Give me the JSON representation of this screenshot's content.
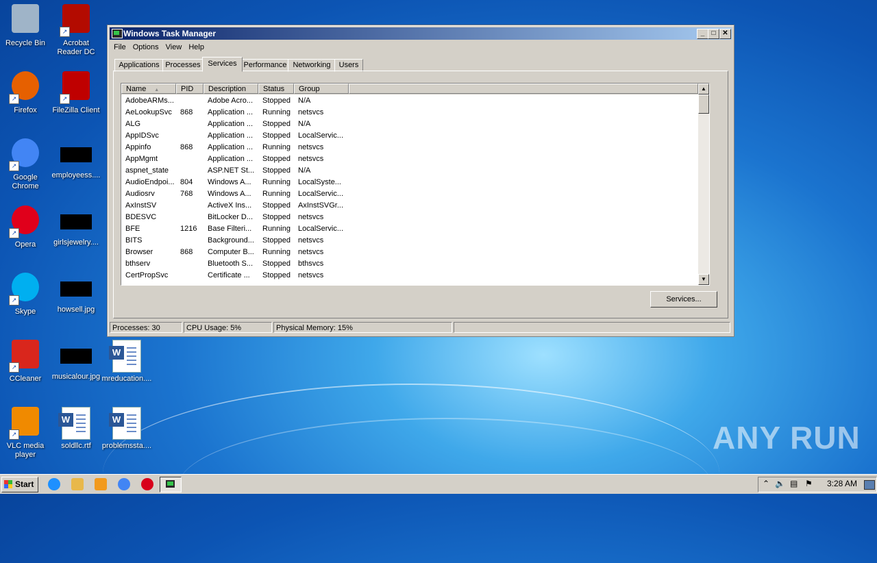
{
  "desktop": {
    "icons": [
      {
        "label": "Recycle Bin",
        "icon": "recycle-bin-icon"
      },
      {
        "label": "Acrobat Reader DC",
        "icon": "acrobat-icon"
      },
      {
        "label": "Firefox",
        "icon": "firefox-icon"
      },
      {
        "label": "FileZilla Client",
        "icon": "filezilla-icon"
      },
      {
        "label": "Google Chrome",
        "icon": "chrome-icon"
      },
      {
        "label": "employeess....",
        "icon": "image-thumbnail-icon"
      },
      {
        "label": "Opera",
        "icon": "opera-icon"
      },
      {
        "label": "girlsjewelry....",
        "icon": "image-thumbnail-icon"
      },
      {
        "label": "Skype",
        "icon": "skype-icon"
      },
      {
        "label": "howsell.jpg",
        "icon": "image-thumbnail-icon"
      },
      {
        "label": "CCleaner",
        "icon": "ccleaner-icon"
      },
      {
        "label": "musicalour.jpg",
        "icon": "image-thumbnail-icon"
      },
      {
        "label": "mreducation....",
        "icon": "word-doc-icon"
      },
      {
        "label": "VLC media player",
        "icon": "vlc-icon"
      },
      {
        "label": "soldllc.rtf",
        "icon": "word-doc-icon"
      },
      {
        "label": "problemssta....",
        "icon": "word-doc-icon"
      }
    ],
    "watermark": "ANY RUN"
  },
  "window": {
    "title": "Windows Task Manager",
    "menu": [
      "File",
      "Options",
      "View",
      "Help"
    ],
    "tabs": [
      "Applications",
      "Processes",
      "Services",
      "Performance",
      "Networking",
      "Users"
    ],
    "active_tab": "Services",
    "columns": [
      "Name",
      "PID",
      "Description",
      "Status",
      "Group"
    ],
    "sort_column": "Name",
    "services": [
      {
        "name": "AdobeARMs...",
        "pid": "",
        "desc": "Adobe Acro...",
        "status": "Stopped",
        "group": "N/A"
      },
      {
        "name": "AeLookupSvc",
        "pid": "868",
        "desc": "Application ...",
        "status": "Running",
        "group": "netsvcs"
      },
      {
        "name": "ALG",
        "pid": "",
        "desc": "Application ...",
        "status": "Stopped",
        "group": "N/A"
      },
      {
        "name": "AppIDSvc",
        "pid": "",
        "desc": "Application ...",
        "status": "Stopped",
        "group": "LocalServic..."
      },
      {
        "name": "Appinfo",
        "pid": "868",
        "desc": "Application ...",
        "status": "Running",
        "group": "netsvcs"
      },
      {
        "name": "AppMgmt",
        "pid": "",
        "desc": "Application ...",
        "status": "Stopped",
        "group": "netsvcs"
      },
      {
        "name": "aspnet_state",
        "pid": "",
        "desc": "ASP.NET St...",
        "status": "Stopped",
        "group": "N/A"
      },
      {
        "name": "AudioEndpoi...",
        "pid": "804",
        "desc": "Windows A...",
        "status": "Running",
        "group": "LocalSyste..."
      },
      {
        "name": "Audiosrv",
        "pid": "768",
        "desc": "Windows A...",
        "status": "Running",
        "group": "LocalServic..."
      },
      {
        "name": "AxInstSV",
        "pid": "",
        "desc": "ActiveX Ins...",
        "status": "Stopped",
        "group": "AxInstSVGr..."
      },
      {
        "name": "BDESVC",
        "pid": "",
        "desc": "BitLocker D...",
        "status": "Stopped",
        "group": "netsvcs"
      },
      {
        "name": "BFE",
        "pid": "1216",
        "desc": "Base Filteri...",
        "status": "Running",
        "group": "LocalServic..."
      },
      {
        "name": "BITS",
        "pid": "",
        "desc": "Background...",
        "status": "Stopped",
        "group": "netsvcs"
      },
      {
        "name": "Browser",
        "pid": "868",
        "desc": "Computer B...",
        "status": "Running",
        "group": "netsvcs"
      },
      {
        "name": "bthserv",
        "pid": "",
        "desc": "Bluetooth S...",
        "status": "Stopped",
        "group": "bthsvcs"
      },
      {
        "name": "CertPropSvc",
        "pid": "",
        "desc": "Certificate ...",
        "status": "Stopped",
        "group": "netsvcs"
      }
    ],
    "services_button": "Services...",
    "status": {
      "processes": "Processes: 30",
      "cpu": "CPU Usage: 5%",
      "memory": "Physical Memory: 15%"
    }
  },
  "taskbar": {
    "start_label": "Start",
    "quicklaunch": [
      "ie-icon",
      "explorer-icon",
      "media-player-icon",
      "chrome-icon",
      "opera-icon"
    ],
    "clock": "3:28 AM"
  }
}
